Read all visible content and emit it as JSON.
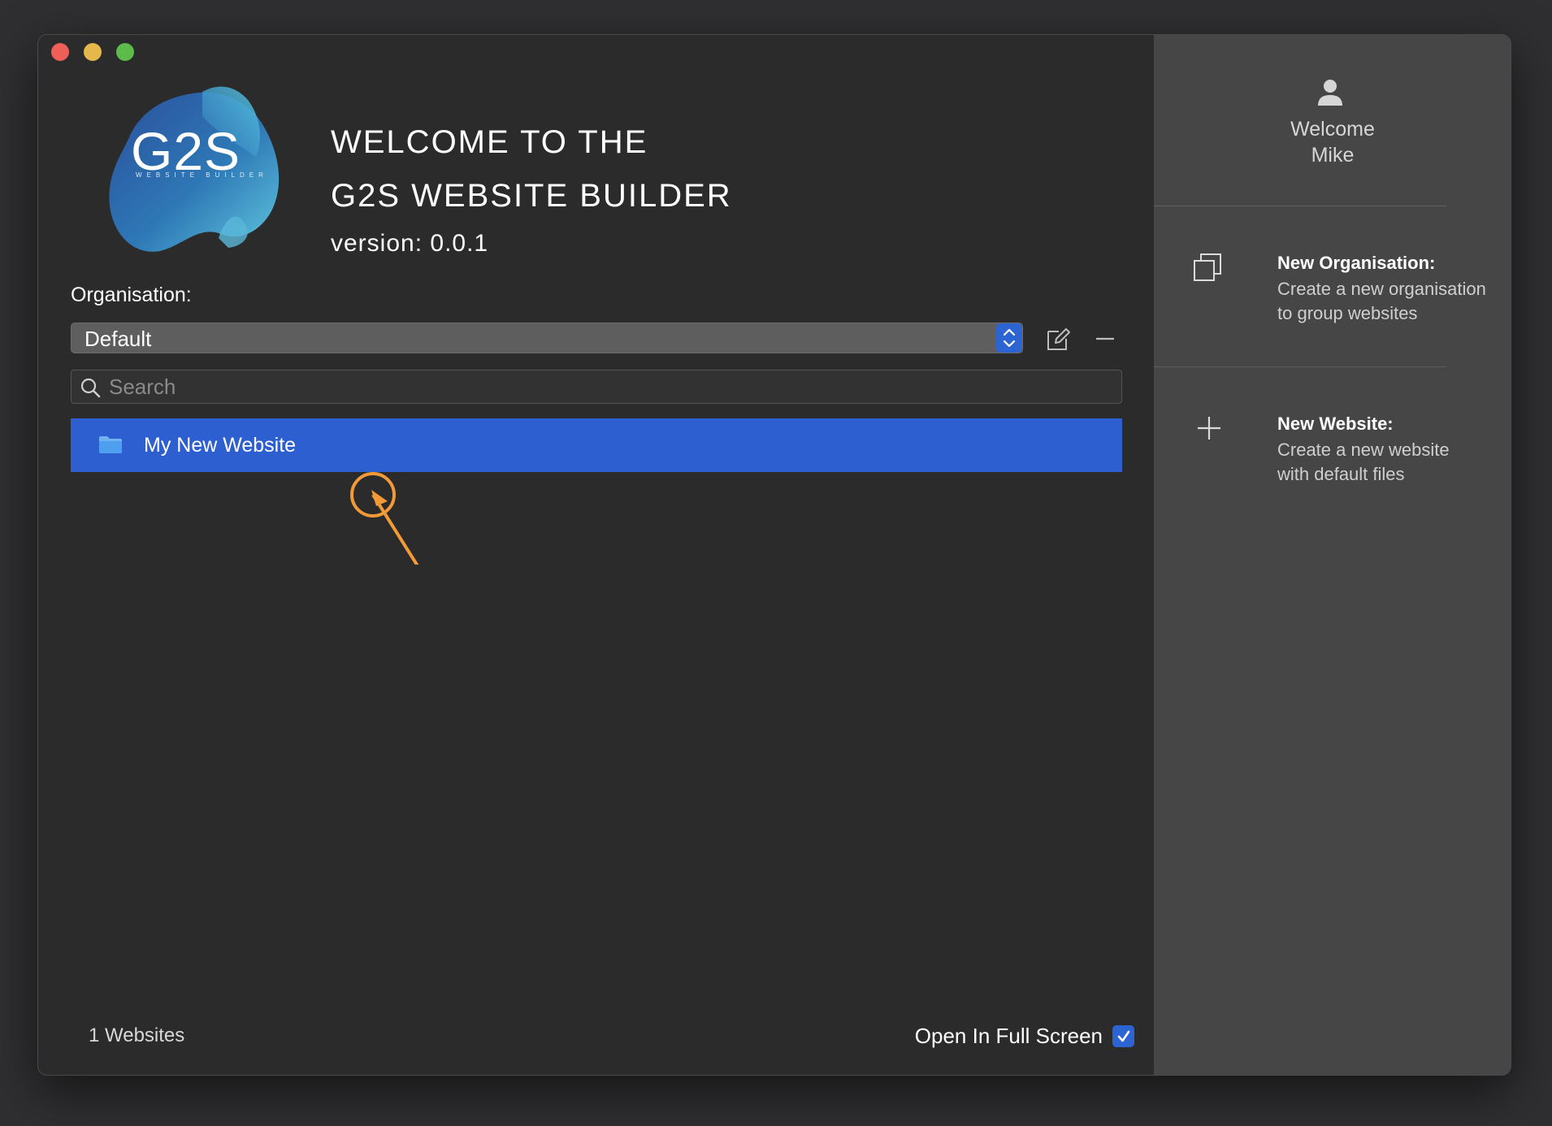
{
  "window": {
    "welcome_line1": "WELCOME TO THE",
    "welcome_line2": "G2S WEBSITE BUILDER",
    "version": "version: 0.0.1",
    "logo_text": "G2S",
    "logo_subtext": "WEBSITE BUILDER"
  },
  "organisation": {
    "label": "Organisation:",
    "selected": "Default"
  },
  "search": {
    "placeholder": "Search",
    "value": ""
  },
  "websites": [
    {
      "name": "My New Website",
      "selected": true
    }
  ],
  "footer": {
    "count_text": "1 Websites",
    "fullscreen_label": "Open In Full Screen",
    "fullscreen_checked": true
  },
  "sidebar": {
    "welcome": "Welcome",
    "user_name": "Mike",
    "new_org_title": "New Organisation:",
    "new_org_desc1": "Create a new organisation",
    "new_org_desc2": "to group websites",
    "new_site_title": "New Website:",
    "new_site_desc1": "Create a new website",
    "new_site_desc2": "with default files"
  },
  "colors": {
    "accent": "#2d5fd1",
    "annotation": "#f29a38",
    "window_bg": "#2b2b2b",
    "sidebar_bg": "#464646"
  }
}
